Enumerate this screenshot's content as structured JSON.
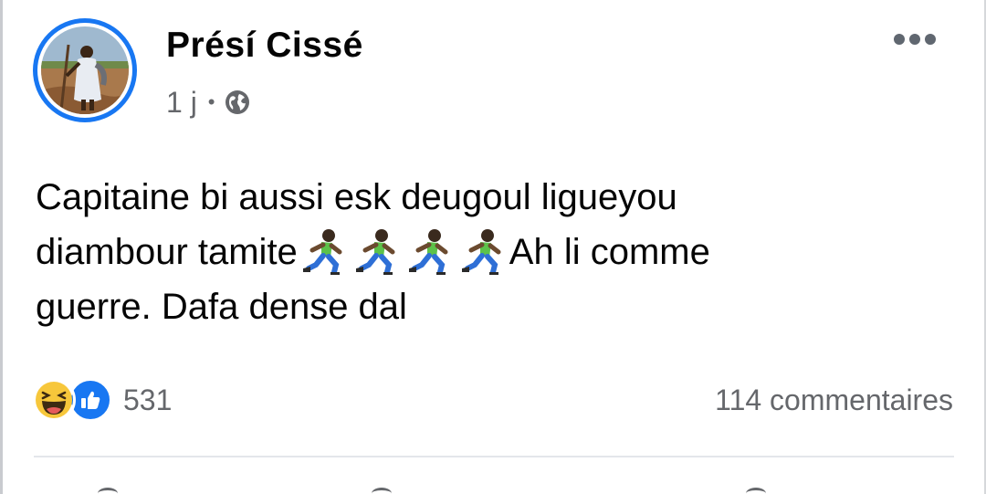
{
  "post": {
    "author": "Présí Cissé",
    "time": "1 j",
    "separator": "•",
    "privacy_icon": "globe-icon",
    "text_lines": [
      "Capitaine bi aussi esk deugoul ligueyou",
      "diambour tamite",
      "Ah li comme",
      "guerre. Dafa dense dal"
    ],
    "emoji": "person-running-icon"
  },
  "reactions": {
    "icons": [
      "haha-emoji-icon",
      "like-thumb-icon"
    ],
    "count": "531"
  },
  "comments": {
    "count_label": "114 commentaires"
  },
  "colors": {
    "accent": "#1877f2",
    "secondary_text": "#65676b",
    "primary_text": "#050505",
    "divider": "#e4e6eb",
    "haha_yellow": "#f7c73b"
  }
}
